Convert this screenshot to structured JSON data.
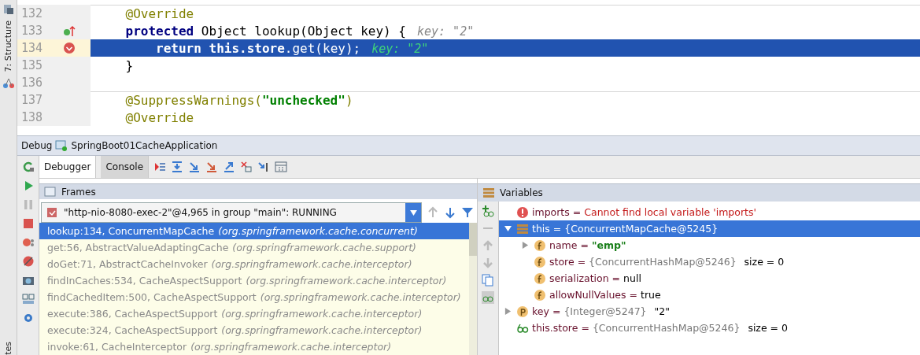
{
  "side_stripe": {
    "structure_label": "7: Structure",
    "bottom_label": "tes"
  },
  "editor": {
    "lines": [
      {
        "number": "132",
        "breakpoint": false,
        "override": false,
        "current": false,
        "separator": true,
        "tokens": [
          {
            "kind": "annotation",
            "text": "    @Override"
          }
        ]
      },
      {
        "number": "133",
        "breakpoint": false,
        "override": true,
        "current": false,
        "separator": false,
        "tokens": [
          {
            "kind": "keyword",
            "text": "    protected"
          },
          {
            "kind": "plain",
            "text": " Object lookup(Object key) {"
          }
        ],
        "hint": "key: \"2\""
      },
      {
        "number": "134",
        "breakpoint": true,
        "override": false,
        "current": true,
        "separator": false,
        "tokens": [
          {
            "kind": "keyword",
            "text": "        return this.store"
          },
          {
            "kind": "plain",
            "text": ".get(key);"
          }
        ],
        "hint": "key: \"2\""
      },
      {
        "number": "135",
        "breakpoint": false,
        "override": false,
        "current": false,
        "separator": false,
        "tokens": [
          {
            "kind": "plain",
            "text": "    }"
          }
        ]
      },
      {
        "number": "136",
        "breakpoint": false,
        "override": false,
        "current": false,
        "separator": false
      },
      {
        "number": "137",
        "breakpoint": false,
        "override": false,
        "current": false,
        "separator": true,
        "tokens": [
          {
            "kind": "annotation",
            "text": "    @SuppressWarnings("
          },
          {
            "kind": "string",
            "text": "\"unchecked\""
          },
          {
            "kind": "annotation",
            "text": ")"
          }
        ]
      },
      {
        "number": "138",
        "breakpoint": false,
        "override": false,
        "current": false,
        "separator": false,
        "tokens": [
          {
            "kind": "annotation",
            "text": "    @Override"
          }
        ]
      }
    ]
  },
  "debug_header": {
    "label": "Debug",
    "config": "SpringBoot01CacheApplication"
  },
  "tabs": [
    {
      "label": "Debugger",
      "selected": true
    },
    {
      "label": "Console",
      "selected": false
    }
  ],
  "frames": {
    "title": "Frames",
    "thread": "\"http-nio-8080-exec-2\"@4,965 in group \"main\": RUNNING",
    "items": [
      {
        "text": "lookup:134, ConcurrentMapCache *(org.springframework.cache.concurrent)*",
        "selected": true
      },
      {
        "text": "get:56, AbstractValueAdaptingCache *(org.springframework.cache.support)*",
        "selected": false
      },
      {
        "text": "doGet:71, AbstractCacheInvoker *(org.springframework.cache.interceptor)*",
        "selected": false
      },
      {
        "text": "findInCaches:534, CacheAspectSupport *(org.springframework.cache.interceptor)*",
        "selected": false
      },
      {
        "text": "findCachedItem:500, CacheAspectSupport *(org.springframework.cache.interceptor)*",
        "selected": false
      },
      {
        "text": "execute:386, CacheAspectSupport *(org.springframework.cache.interceptor)*",
        "selected": false
      },
      {
        "text": "execute:324, CacheAspectSupport *(org.springframework.cache.interceptor)*",
        "selected": false
      },
      {
        "text": "invoke:61, CacheInterceptor *(org.springframework.cache.interceptor)*",
        "selected": false
      }
    ]
  },
  "variables": {
    "title": "Variables",
    "items": [
      {
        "kind": "error",
        "name": "imports",
        "operator": "=",
        "value": "Cannot find local variable 'imports'",
        "color": "#c41a1a",
        "selected": false
      },
      {
        "kind": "object",
        "name": "this",
        "operator": "=",
        "value": "{ConcurrentMapCache@5245}",
        "selected": true,
        "expanded": true,
        "children": [
          {
            "kind": "field",
            "name": "name",
            "operator": "=",
            "value": "**\"emp\"**",
            "color": "#1a7f1a",
            "selected": false,
            "expanded": false
          },
          {
            "kind": "field",
            "name": "store",
            "operator": "=",
            "value": "{ConcurrentHashMap@5246}",
            "color": "#777777",
            "suffix": "size = 0",
            "selected": false
          },
          {
            "kind": "field",
            "name": "serialization",
            "operator": "=",
            "value": "null",
            "selected": false
          },
          {
            "kind": "field",
            "name": "allowNullValues",
            "operator": "=",
            "value": "true",
            "selected": false
          }
        ]
      },
      {
        "kind": "param",
        "name": "key",
        "operator": "=",
        "value": "{Integer@5247}",
        "color": "#777777",
        "suffix": "\"2\"",
        "selected": false,
        "expanded": false
      },
      {
        "kind": "watch",
        "name": "this.store",
        "operator": "=",
        "value": "{ConcurrentHashMap@5246}",
        "color": "#777777",
        "suffix": "size = 0",
        "selected": false
      }
    ]
  }
}
